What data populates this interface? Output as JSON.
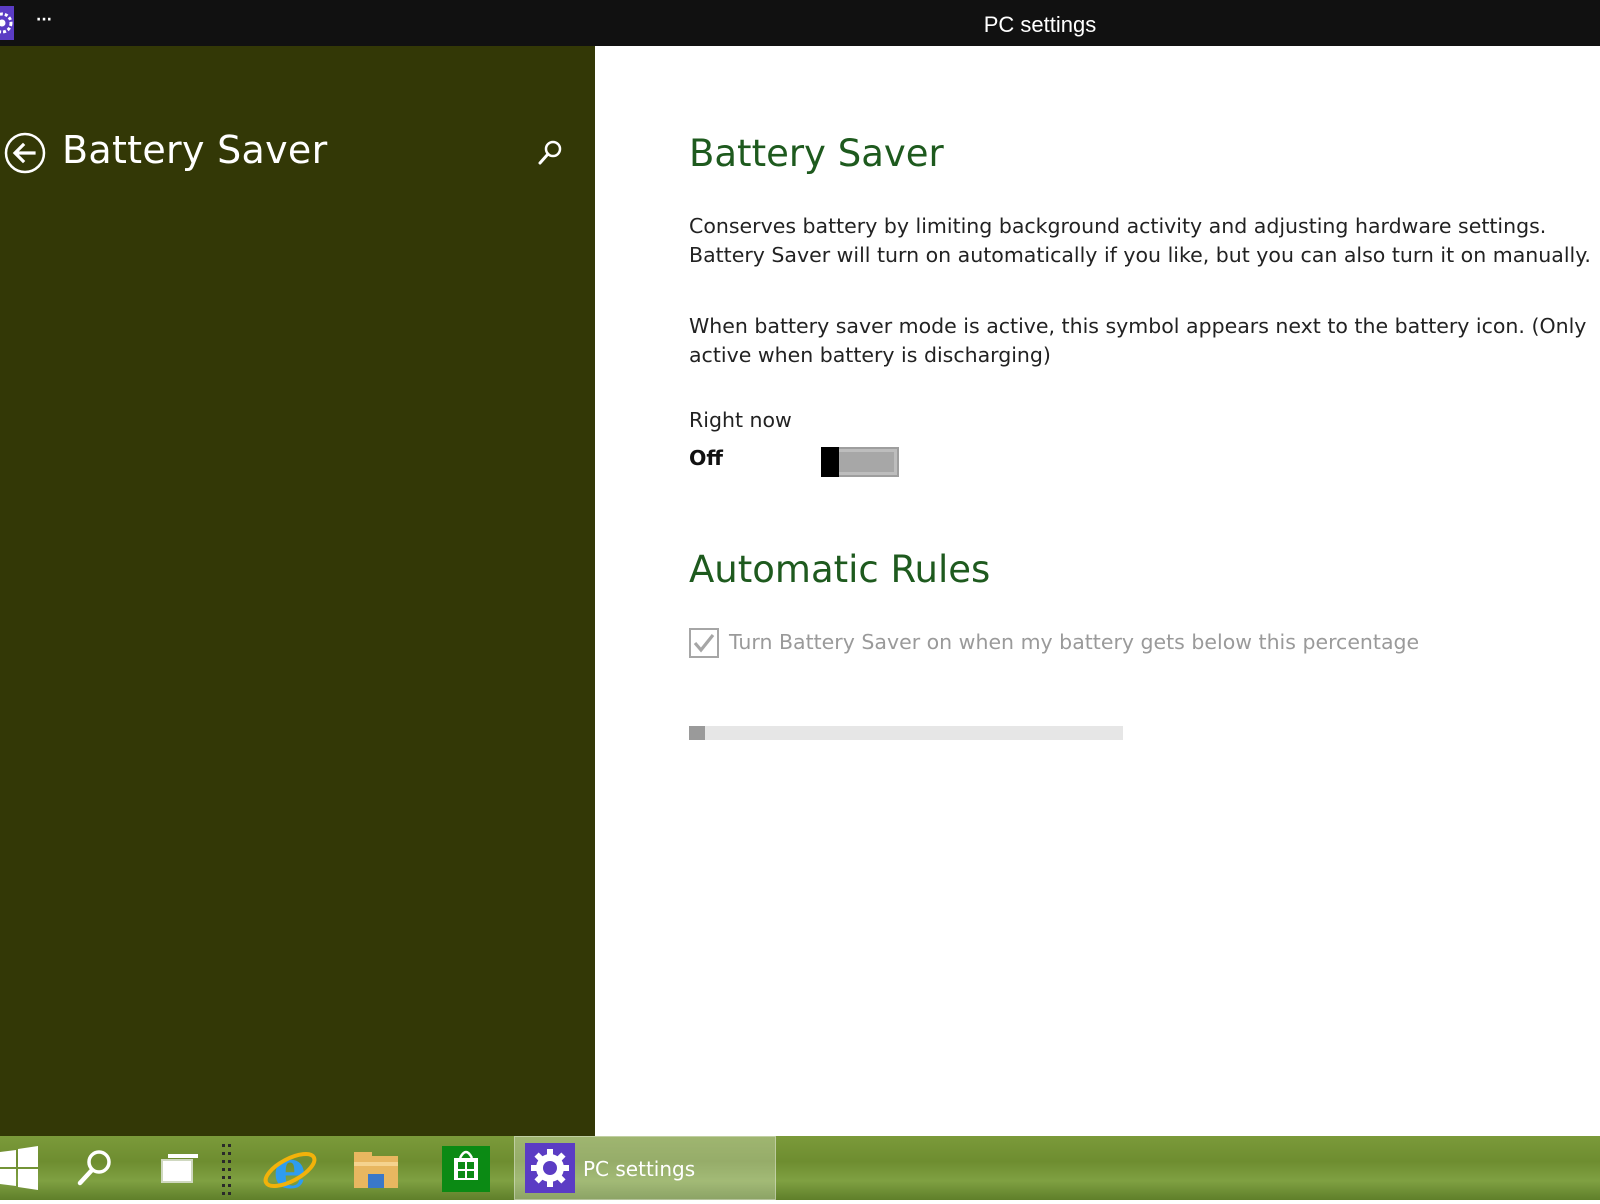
{
  "window": {
    "title": "PC settings",
    "more_label": "···"
  },
  "left_pane": {
    "title": "Battery Saver",
    "background": "#333806"
  },
  "content": {
    "heading": "Battery Saver",
    "description": "Conserves battery by limiting background activity and adjusting hardware settings. Battery Saver will turn on automatically if you like, but you can also turn it on manually.",
    "symbol_note": "When battery saver mode is active, this symbol appears next to the battery icon. (Only active when battery is discharging)",
    "right_now": {
      "label": "Right now",
      "state": "Off",
      "on": false
    },
    "rules_heading": "Automatic Rules",
    "auto_rule": {
      "label": "Turn Battery Saver on when my battery gets below this percentage",
      "checked": true,
      "enabled": false
    },
    "threshold_slider": {
      "value_fraction": 0.0
    },
    "heading_color": "#1e5a1e"
  },
  "taskbar": {
    "active_app_label": "PC settings",
    "items": [
      "start-icon",
      "search-icon",
      "task-view-icon",
      "internet-explorer-icon",
      "file-explorer-icon",
      "store-icon",
      "gear-icon"
    ]
  }
}
